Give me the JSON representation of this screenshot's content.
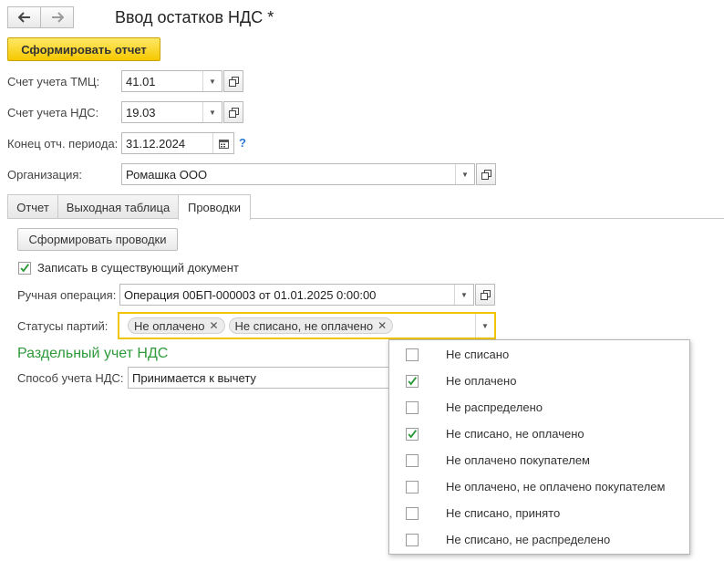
{
  "nav": {
    "back_icon": "arrow-left-icon",
    "forward_icon": "arrow-right-icon"
  },
  "header": {
    "title": "Ввод остатков НДС *"
  },
  "toolbar": {
    "generate_report_label": "Сформировать отчет"
  },
  "form": {
    "tmc_account": {
      "label": "Счет учета ТМЦ:",
      "value": "41.01"
    },
    "vat_account": {
      "label": "Счет учета НДС:",
      "value": "19.03"
    },
    "period_end": {
      "label": "Конец отч. периода:",
      "value": "31.12.2024",
      "help": "?"
    },
    "organization": {
      "label": "Организация:",
      "value": "Ромашка ООО"
    }
  },
  "tabs": [
    {
      "label": "Отчет",
      "active": false
    },
    {
      "label": "Выходная таблица",
      "active": false
    },
    {
      "label": "Проводки",
      "active": true
    }
  ],
  "postings": {
    "generate_postings_label": "Сформировать проводки",
    "write_existing": {
      "label": "Записать в существующий документ",
      "checked": true
    },
    "manual_operation": {
      "label": "Ручная операция:",
      "value": "Операция 00БП-000003 от 01.01.2025 0:00:00"
    },
    "batch_statuses": {
      "label": "Статусы партий:",
      "selected": [
        "Не оплачено",
        "Не списано, не оплачено"
      ]
    },
    "section_title": "Раздельный учет НДС",
    "vat_method": {
      "label": "Способ учета НДС:",
      "value": "Принимается к вычету"
    }
  },
  "status_options": [
    {
      "label": "Не списано",
      "checked": false
    },
    {
      "label": "Не оплачено",
      "checked": true
    },
    {
      "label": "Не распределено",
      "checked": false
    },
    {
      "label": "Не списано, не оплачено",
      "checked": true
    },
    {
      "label": "Не оплачено покупателем",
      "checked": false
    },
    {
      "label": "Не оплачено, не оплачено покупателем",
      "checked": false
    },
    {
      "label": "Не списано, принято",
      "checked": false
    },
    {
      "label": "Не списано, не распределено",
      "checked": false
    }
  ],
  "colors": {
    "accent_yellow": "#f5c800",
    "section_green": "#2e9a3b",
    "check_green": "#2e9a3b",
    "focus_border": "#f0c400"
  }
}
